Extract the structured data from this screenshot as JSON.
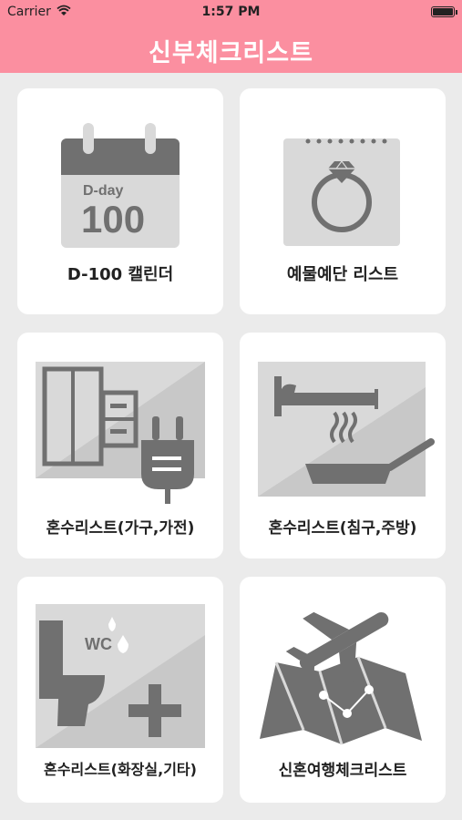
{
  "status_bar": {
    "carrier": "Carrier",
    "time": "1:57 PM",
    "wifi_icon": "wifi-icon",
    "battery_icon": "battery-icon"
  },
  "nav": {
    "title": "신부체크리스트"
  },
  "colors": {
    "header": "#fb8fa0",
    "background": "#ebebeb",
    "card": "#ffffff",
    "icon_dark": "#707070",
    "icon_light": "#d9d9d9"
  },
  "cards": [
    {
      "label": "D-100 캘린더",
      "icon": "calendar-icon",
      "icon_text_top": "D-day",
      "icon_text_big": "100"
    },
    {
      "label": "예물예단 리스트",
      "icon": "ring-icon"
    },
    {
      "label": "혼수리스트(가구,가전)",
      "icon": "furniture-appliance-icon"
    },
    {
      "label": "혼수리스트(침구,주방)",
      "icon": "bed-pan-icon"
    },
    {
      "label": "혼수리스트(화장실,기타)",
      "icon": "toilet-plus-icon",
      "icon_text": "WC"
    },
    {
      "label": "신혼여행체크리스트",
      "icon": "airplane-map-icon"
    }
  ]
}
